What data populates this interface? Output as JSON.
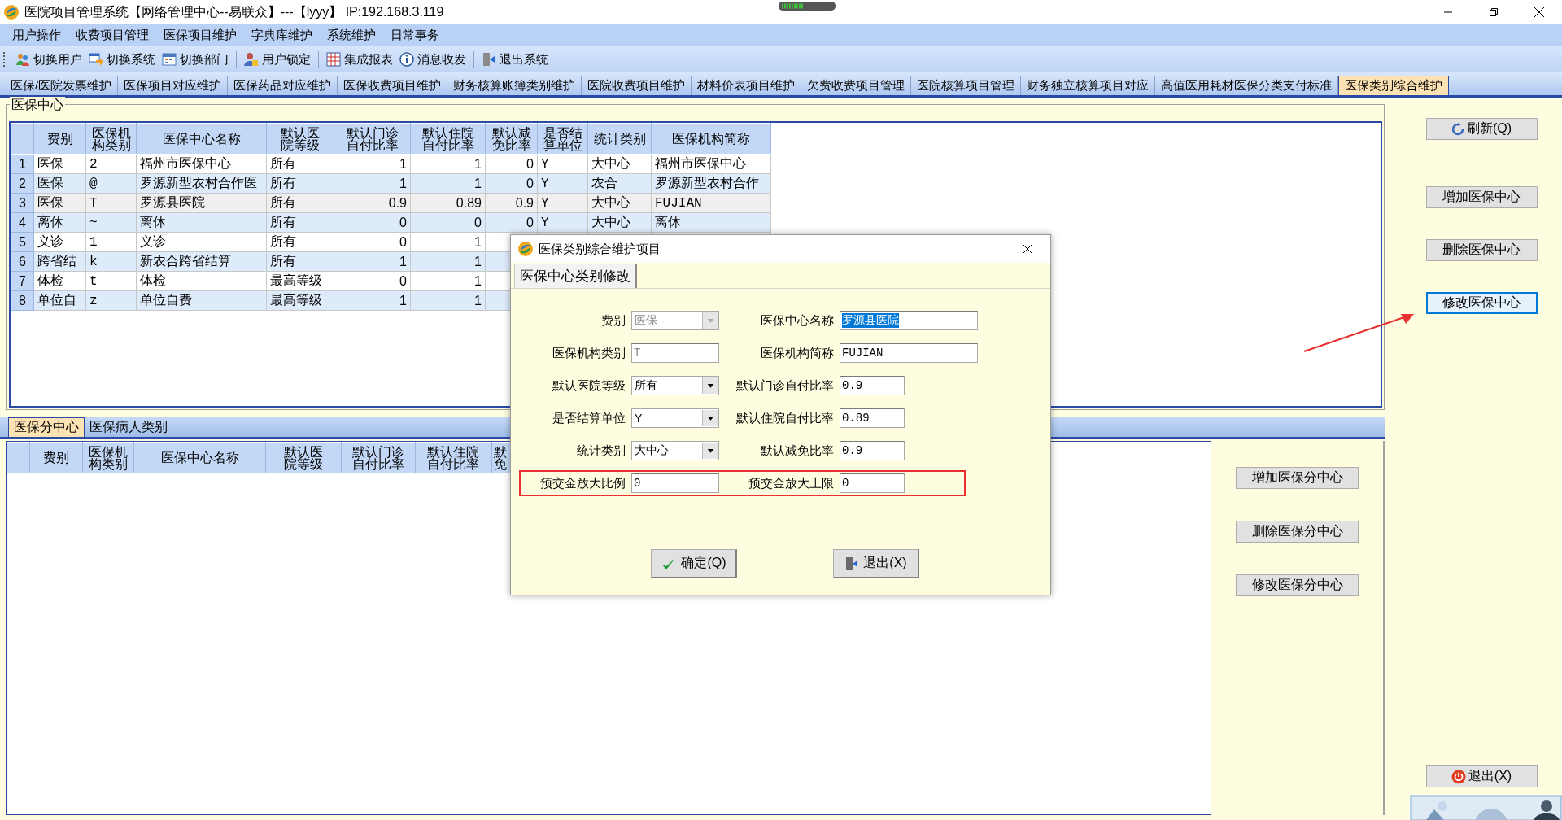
{
  "window": {
    "title": "医院项目管理系统【网络管理中心--易联众】---【lyyy】 IP:192.168.3.119"
  },
  "menu": [
    "用户操作",
    "收费项目管理",
    "医保项目维护",
    "字典库维护",
    "系统维护",
    "日常事务"
  ],
  "toolbar": [
    [
      {
        "label": "切换用户",
        "kind": "users"
      },
      {
        "label": "切换系统",
        "kind": "switch"
      },
      {
        "label": "切换部门",
        "kind": "calendar"
      }
    ],
    [
      {
        "label": "用户锁定",
        "kind": "lock"
      }
    ],
    [
      {
        "label": "集成报表",
        "kind": "report"
      },
      {
        "label": "消息收发",
        "kind": "info"
      }
    ],
    [
      {
        "label": "退出系统",
        "kind": "exit"
      }
    ]
  ],
  "tabs": [
    {
      "label": "医保/医院发票维护",
      "selected": false
    },
    {
      "label": "医保项目对应维护",
      "selected": false
    },
    {
      "label": "医保药品对应维护",
      "selected": false
    },
    {
      "label": "医保收费项目维护",
      "selected": false
    },
    {
      "label": "财务核算账簿类别维护",
      "selected": false
    },
    {
      "label": "医院收费项目维护",
      "selected": false
    },
    {
      "label": "材料价表项目维护",
      "selected": false
    },
    {
      "label": "欠费收费项目管理",
      "selected": false
    },
    {
      "label": "医院核算项目管理",
      "selected": false
    },
    {
      "label": "财务独立核算项目对应",
      "selected": false
    },
    {
      "label": "高值医用耗材医保分类支付标准",
      "selected": false
    },
    {
      "label": "医保类别综合维护",
      "selected": true
    }
  ],
  "center_group": {
    "title": "医保中心",
    "table": {
      "columns": [
        "费别",
        "医保机构类别",
        "医保中心名称",
        "默认医院等级",
        "默认门诊自付比率",
        "默认住院自付比率",
        "默认减免比率",
        "是否结算单位",
        "统计类别",
        "医保机构简称"
      ],
      "rows": [
        {
          "number": "1",
          "selected": false,
          "cells": [
            "医保",
            "2",
            "福州市医保中心",
            "所有",
            "1",
            "1",
            "0",
            "Y",
            "大中心",
            "福州市医保中心"
          ]
        },
        {
          "number": "2",
          "selected": false,
          "cells": [
            "医保",
            "@",
            "罗源新型农村合作医",
            "所有",
            "1",
            "1",
            "0",
            "Y",
            "农合",
            "罗源新型农村合作"
          ]
        },
        {
          "number": "3",
          "selected": true,
          "cells": [
            "医保",
            "T",
            "罗源县医院",
            "所有",
            "0.9",
            "0.89",
            "0.9",
            "Y",
            "大中心",
            "FUJIAN"
          ]
        },
        {
          "number": "4",
          "selected": false,
          "cells": [
            "离休",
            "~",
            "离休",
            "所有",
            "0",
            "0",
            "0",
            "Y",
            "大中心",
            "离休"
          ]
        },
        {
          "number": "5",
          "selected": false,
          "cells": [
            "义诊",
            "1",
            "义诊",
            "所有",
            "0",
            "1"
          ]
        },
        {
          "number": "6",
          "selected": false,
          "cells": [
            "跨省结",
            "k",
            "新农合跨省结算",
            "所有",
            "1",
            "1"
          ]
        },
        {
          "number": "7",
          "selected": false,
          "cells": [
            "体检",
            "t",
            "体检",
            "最高等级",
            "0",
            "1"
          ]
        },
        {
          "number": "8",
          "selected": false,
          "cells": [
            "单位自",
            "z",
            "单位自费",
            "最高等级",
            "1",
            "1"
          ]
        }
      ]
    }
  },
  "right_buttons": [
    {
      "label": "刷新(Q)",
      "kind": "refresh",
      "focused": false
    },
    {
      "label": "增加医保中心",
      "kind": "plain",
      "focused": false
    },
    {
      "label": "删除医保中心",
      "kind": "plain",
      "focused": false
    },
    {
      "label": "修改医保中心",
      "kind": "plain",
      "focused": true
    }
  ],
  "sub_tabs": [
    {
      "label": "医保分中心",
      "selected": true
    },
    {
      "label": "医保病人类别",
      "selected": false
    }
  ],
  "sub_table": {
    "columns": [
      "费别",
      "医保机构类别",
      "医保中心名称",
      "默认医院等级",
      "默认门诊自付比率",
      "默认住院自付比率",
      "默免"
    ]
  },
  "sub_buttons": [
    "增加医保分中心",
    "删除医保分中心",
    "修改医保分中心"
  ],
  "exit_button": {
    "label": "退出(X)"
  },
  "dialog": {
    "title": "医保类别综合维护项目",
    "tab": "医保中心类别修改",
    "rows": [
      {
        "highlighted": false,
        "left": {
          "label": "费别",
          "value": "医保",
          "kind": "select",
          "disabled": true
        },
        "right": {
          "label": "医保中心名称",
          "value": "罗源县医院",
          "kind": "text",
          "disabled": false,
          "text_selected": true
        }
      },
      {
        "highlighted": false,
        "left": {
          "label": "医保机构类别",
          "value": "T",
          "kind": "text",
          "disabled": true
        },
        "right": {
          "label": "医保机构简称",
          "value": "FUJIAN",
          "kind": "text",
          "disabled": false,
          "text_selected": false
        }
      },
      {
        "highlighted": false,
        "left": {
          "label": "默认医院等级",
          "value": "所有",
          "kind": "select",
          "disabled": false
        },
        "right": {
          "label": "默认门诊自付比率",
          "value": "0.9",
          "kind": "text",
          "disabled": false,
          "text_selected": false
        }
      },
      {
        "highlighted": false,
        "left": {
          "label": "是否结算单位",
          "value": "Y",
          "kind": "select",
          "disabled": false
        },
        "right": {
          "label": "默认住院自付比率",
          "value": "0.89",
          "kind": "text",
          "disabled": false,
          "text_selected": false
        }
      },
      {
        "highlighted": false,
        "left": {
          "label": "统计类别",
          "value": "大中心",
          "kind": "select",
          "disabled": false
        },
        "right": {
          "label": "默认减免比率",
          "value": "0.9",
          "kind": "text",
          "disabled": false,
          "text_selected": false
        }
      },
      {
        "highlighted": true,
        "left": {
          "label": "预交金放大比例",
          "value": "0",
          "kind": "text",
          "disabled": false
        },
        "right": {
          "label": "预交金放大上限",
          "value": "0",
          "kind": "text",
          "disabled": false,
          "text_selected": false
        }
      }
    ],
    "buttons": [
      {
        "label": "确定(Q)",
        "kind": "ok"
      },
      {
        "label": "退出(X)",
        "kind": "exit"
      }
    ]
  }
}
